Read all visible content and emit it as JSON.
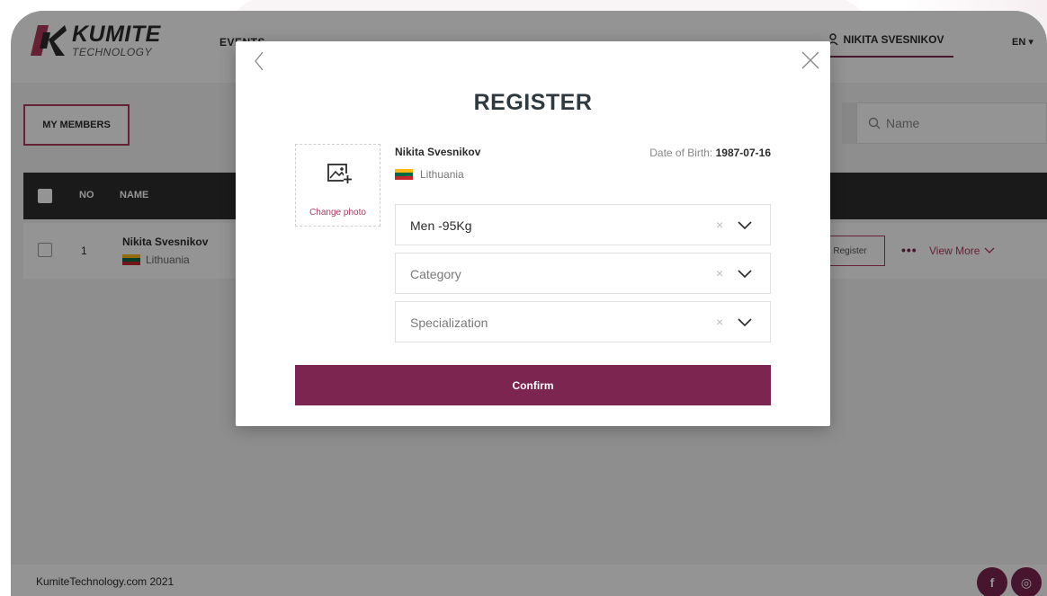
{
  "app": {
    "logo_title": "KUMITE",
    "logo_subtitle": "TECHNOLOGY",
    "nav_events": "EVENTS",
    "user_name": "NIKITA SVESNIKOV",
    "language": "EN ▾"
  },
  "page": {
    "my_members_label": "MY MEMBERS",
    "search_placeholder": "Name"
  },
  "table": {
    "headers": {
      "no": "NO",
      "name": "NAME"
    },
    "rows": [
      {
        "no": "1",
        "name": "Nikita Svesnikov",
        "country": "Lithuania",
        "register_label": "Register",
        "more_dots": "•••",
        "view_more_label": "View More"
      }
    ]
  },
  "footer": {
    "text": "KumiteTechnology.com 2021",
    "social": [
      "f",
      "◎"
    ]
  },
  "modal": {
    "title": "REGISTER",
    "change_photo_label": "Change photo",
    "athlete_name": "Nikita Svesnikov",
    "athlete_country": "Lithuania",
    "dob_label": "Date of Birth:",
    "dob_value": "1987-07-16",
    "fields": [
      {
        "value": "Men -95Kg",
        "placeholder": "",
        "filled": true
      },
      {
        "value": "",
        "placeholder": "Category",
        "filled": false
      },
      {
        "value": "",
        "placeholder": "Specialization",
        "filled": false
      }
    ],
    "clear_glyph": "×",
    "confirm_label": "Confirm"
  },
  "colors": {
    "brand": "#7b2550",
    "accent": "#b03a5b",
    "table_header": "#2d2d2d",
    "lithuania_flag": [
      "#fdb913",
      "#006a44",
      "#c1272d"
    ]
  },
  "icons": {
    "logo": "kumite-k-logo-icon",
    "user": "user-pin-icon",
    "search": "search-icon",
    "back": "chevron-left-icon",
    "close": "close-icon",
    "photo": "add-photo-icon",
    "dropdown": "chevron-down-icon",
    "clear": "clear-x-icon"
  }
}
